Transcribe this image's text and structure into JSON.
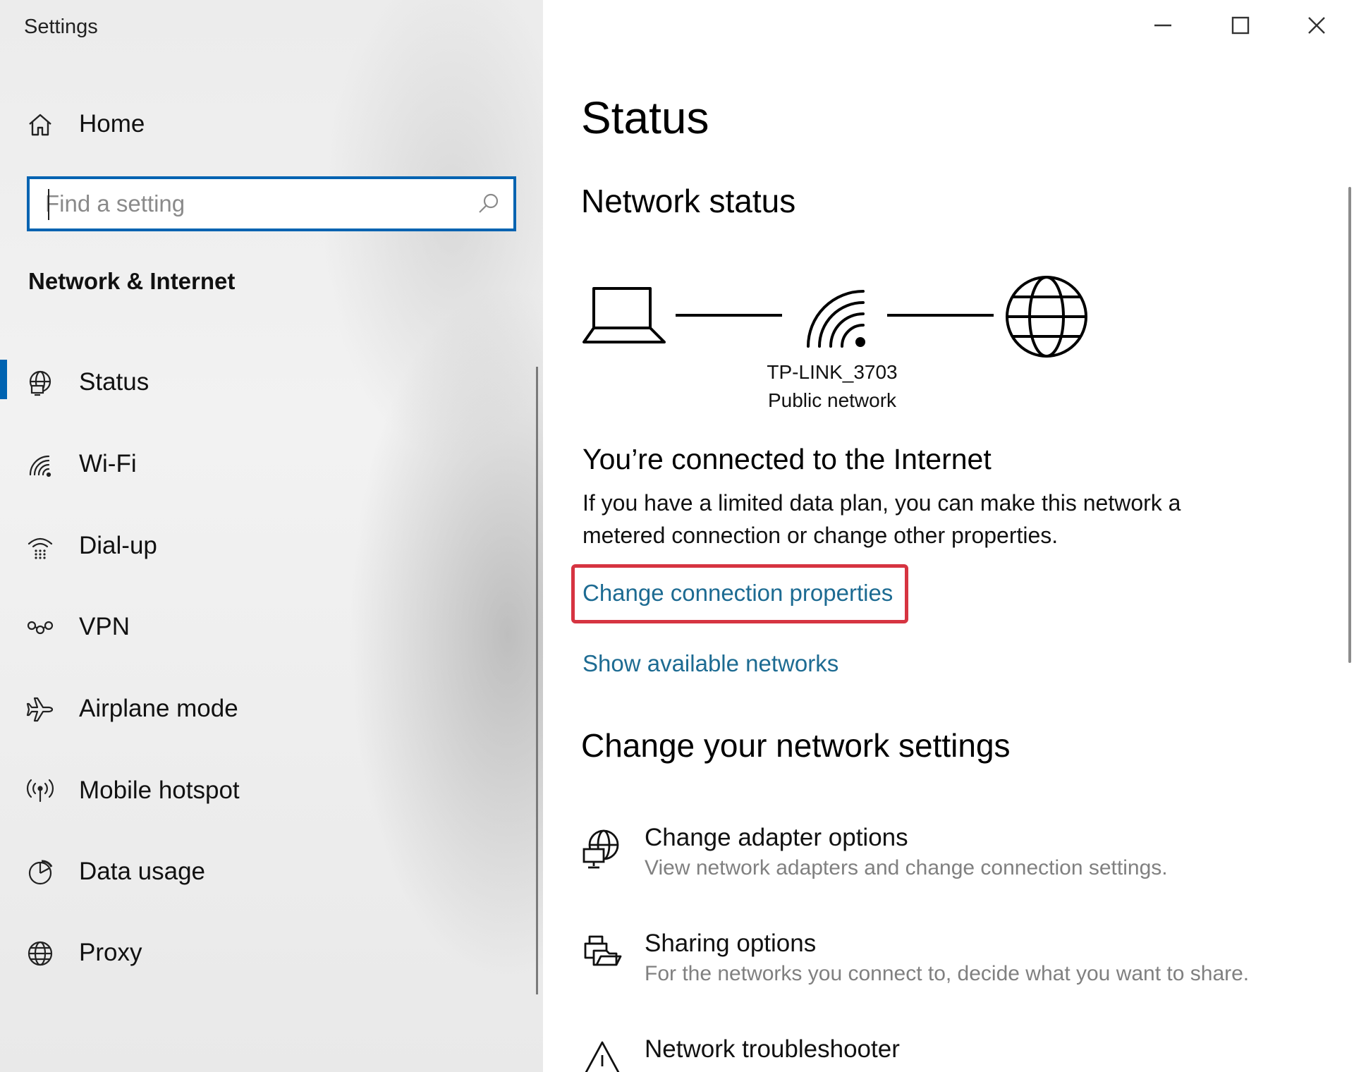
{
  "window": {
    "title": "Settings",
    "minimize_icon": "minimize-icon",
    "maximize_icon": "maximize-icon",
    "close_icon": "close-icon"
  },
  "sidebar": {
    "home_label": "Home",
    "search": {
      "placeholder": "Find a setting",
      "icon": "search-icon"
    },
    "section_heading": "Network & Internet",
    "items": [
      {
        "label": "Status",
        "icon": "status-globe-icon",
        "selected": true
      },
      {
        "label": "Wi-Fi",
        "icon": "wifi-icon"
      },
      {
        "label": "Dial-up",
        "icon": "dialup-icon"
      },
      {
        "label": "VPN",
        "icon": "vpn-icon"
      },
      {
        "label": "Airplane mode",
        "icon": "airplane-icon"
      },
      {
        "label": "Mobile hotspot",
        "icon": "hotspot-icon"
      },
      {
        "label": "Data usage",
        "icon": "data-usage-icon"
      },
      {
        "label": "Proxy",
        "icon": "globe-icon"
      }
    ],
    "accent_color": "#0063b1"
  },
  "main": {
    "title": "Status",
    "network_status_heading": "Network status",
    "network": {
      "name": "TP-LINK_3703",
      "type": "Public network"
    },
    "connected_title": "You’re connected to the Internet",
    "connected_desc": "If you have a limited data plan, you can make this network a metered connection or change other properties.",
    "links": {
      "change_properties": "Change connection properties",
      "show_networks": "Show available networks"
    },
    "link_color": "#1d6b92",
    "highlight_color": "#d63441",
    "change_settings_heading": "Change your network settings",
    "settings": [
      {
        "title": "Change adapter options",
        "desc": "View network adapters and change connection settings.",
        "icon": "adapter-icon"
      },
      {
        "title": "Sharing options",
        "desc": "For the networks you connect to, decide what you want to share.",
        "icon": "sharing-icon"
      },
      {
        "title": "Network troubleshooter",
        "desc": "",
        "icon": "warning-icon"
      }
    ]
  }
}
